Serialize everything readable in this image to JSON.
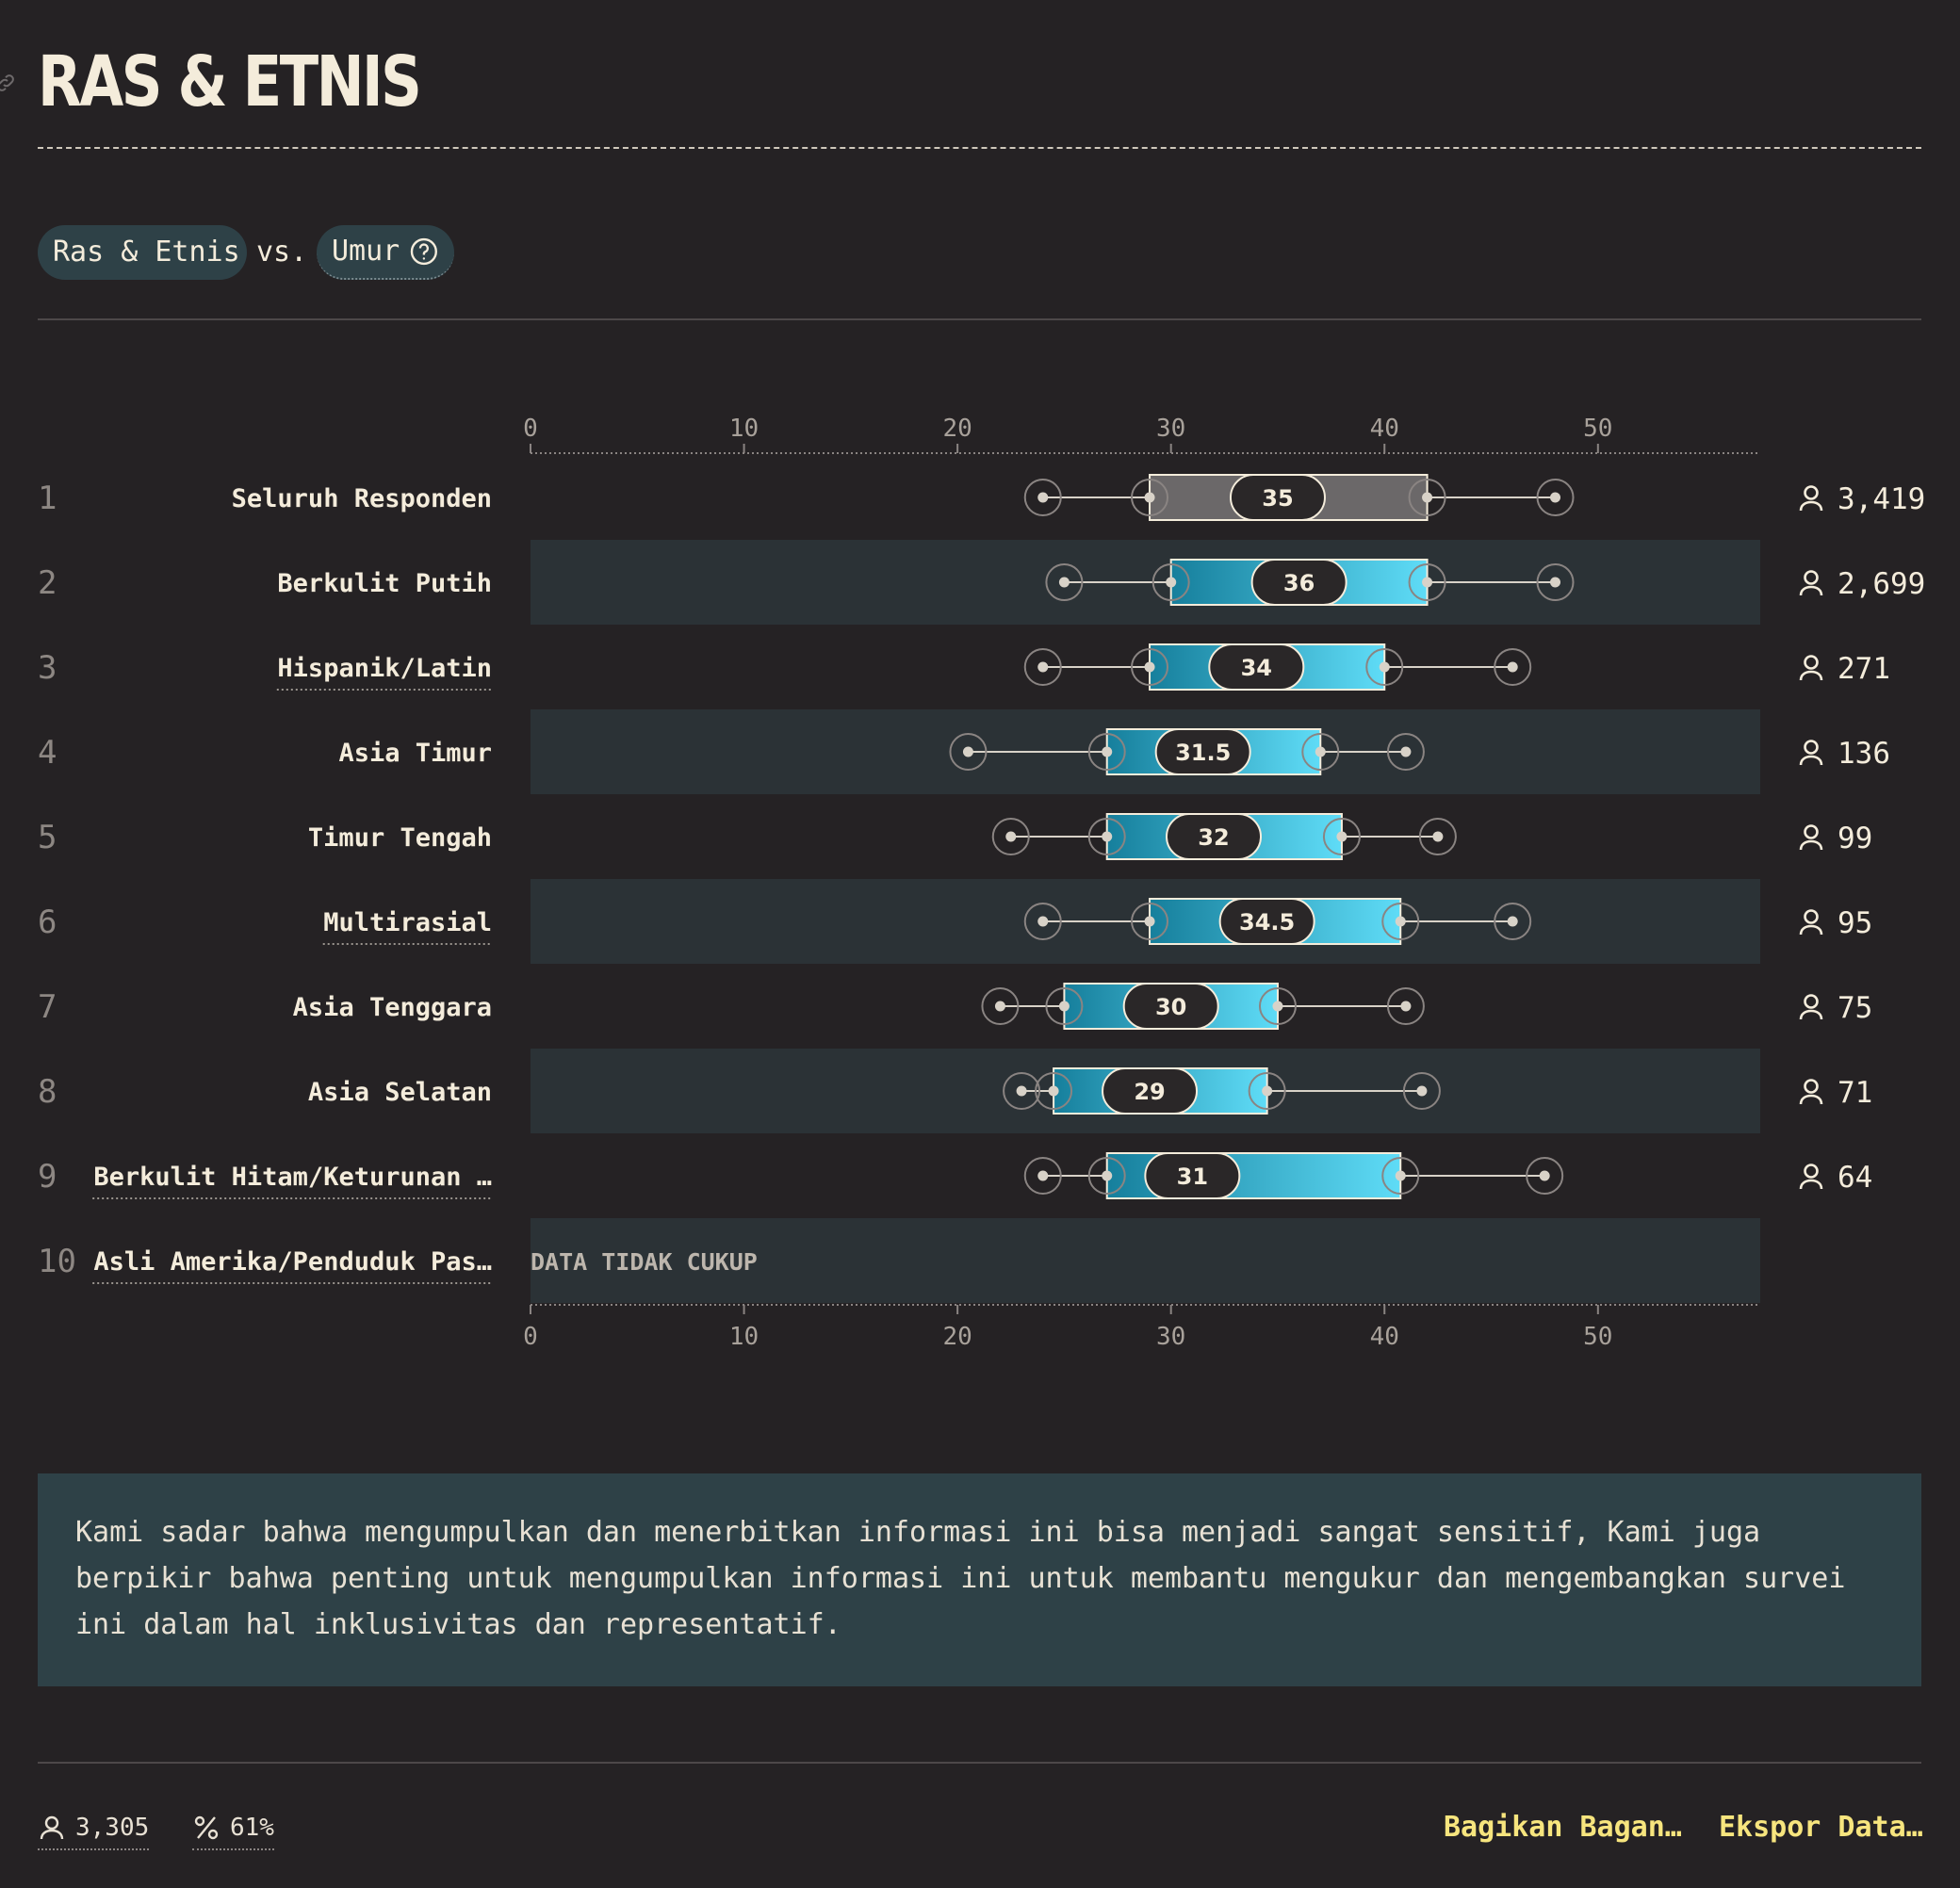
{
  "title": "RAS & ETNIS",
  "comparison": {
    "left_label": "Ras & Etnis",
    "vs_label": "vs.",
    "right_label": "Umur"
  },
  "note": "Kami sadar bahwa mengumpulkan dan menerbitkan informasi ini bisa menjadi sangat sensitif, Kami juga berpikir bahwa penting untuk mengumpulkan informasi ini untuk membantu mengukur dan mengembangkan survei ini dalam hal inklusivitas dan representatif.",
  "footer": {
    "respondents": "3,305",
    "percent": "61%",
    "share_label": "Bagikan Bagan…",
    "export_label": "Ekspor Data…"
  },
  "colors": {
    "accent_start": "#167f9c",
    "accent_end": "#5fdcf7",
    "overall_box": "#6b6869",
    "highlight": "#f7e57e"
  },
  "chart_data": {
    "type": "box",
    "x_ticks": [
      0,
      10,
      20,
      30,
      40,
      50
    ],
    "xlim": [
      0,
      57.6
    ],
    "insufficient_label": "DATA TIDAK CUKUP",
    "rows": [
      {
        "rank": "1",
        "label": "Seluruh Responden",
        "underline": false,
        "count": "3,419",
        "p10": 24,
        "q1": 29,
        "median": 35,
        "q3": 42,
        "p90": 48
      },
      {
        "rank": "2",
        "label": "Berkulit Putih",
        "underline": false,
        "count": "2,699",
        "p10": 25,
        "q1": 30,
        "median": 36,
        "q3": 42,
        "p90": 48
      },
      {
        "rank": "3",
        "label": "Hispanik/Latin",
        "underline": true,
        "count": "271",
        "p10": 24,
        "q1": 29,
        "median": 34,
        "q3": 40,
        "p90": 46
      },
      {
        "rank": "4",
        "label": "Asia Timur",
        "underline": false,
        "count": "136",
        "p10": 20.5,
        "q1": 27,
        "median": 31.5,
        "q3": 37,
        "p90": 41
      },
      {
        "rank": "5",
        "label": "Timur Tengah",
        "underline": false,
        "count": "99",
        "p10": 22.5,
        "q1": 27,
        "median": 32,
        "q3": 38,
        "p90": 42.5
      },
      {
        "rank": "6",
        "label": "Multirasial",
        "underline": true,
        "count": "95",
        "p10": 24,
        "q1": 29,
        "median": 34.5,
        "q3": 40.75,
        "p90": 46
      },
      {
        "rank": "7",
        "label": "Asia Tenggara",
        "underline": false,
        "count": "75",
        "p10": 22,
        "q1": 25,
        "median": 30,
        "q3": 35,
        "p90": 41
      },
      {
        "rank": "8",
        "label": "Asia Selatan",
        "underline": false,
        "count": "71",
        "p10": 23,
        "q1": 24.5,
        "median": 29,
        "q3": 34.5,
        "p90": 41.75
      },
      {
        "rank": "9",
        "label": "Berkulit Hitam/Keturunan …",
        "underline": true,
        "count": "64",
        "p10": 24,
        "q1": 27,
        "median": 31,
        "q3": 40.75,
        "p90": 47.5
      },
      {
        "rank": "10",
        "label": "Asli Amerika/Penduduk Pas…",
        "underline": true,
        "count": "",
        "insufficient": true
      }
    ]
  }
}
